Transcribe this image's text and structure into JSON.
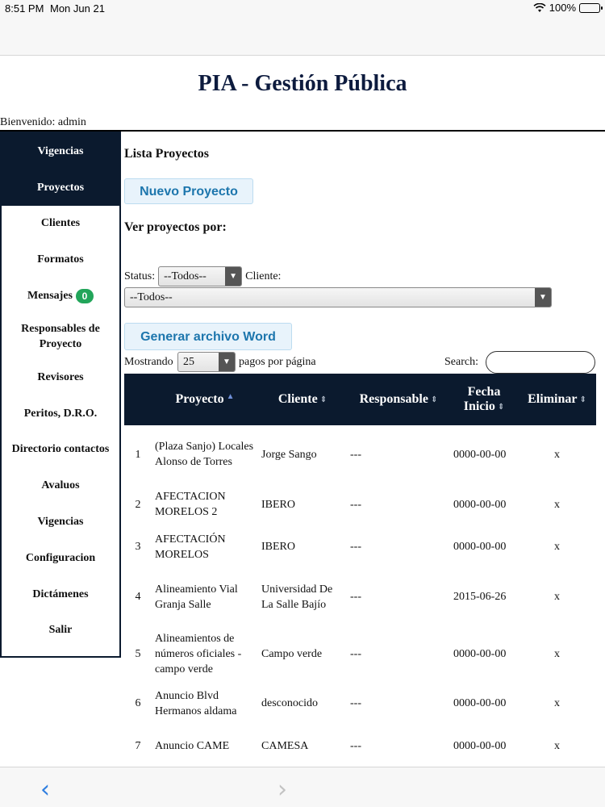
{
  "status_bar": {
    "time": "8:51 PM",
    "date": "Mon Jun 21",
    "battery": "100%"
  },
  "app": {
    "title": "PIA - Gestión Pública",
    "welcome": "Bienvenido: admin"
  },
  "sidebar": {
    "items": [
      {
        "label": "Vigencias"
      },
      {
        "label": "Proyectos"
      },
      {
        "label": "Clientes"
      },
      {
        "label": "Formatos"
      },
      {
        "label": "Mensajes",
        "badge": "0"
      },
      {
        "label": "Responsables de Proyecto"
      },
      {
        "label": "Revisores"
      },
      {
        "label": "Peritos, D.R.O."
      },
      {
        "label": "Directorio contactos"
      },
      {
        "label": "Avaluos"
      },
      {
        "label": "Vigencias"
      },
      {
        "label": "Configuracion"
      },
      {
        "label": "Dictámenes"
      },
      {
        "label": "Salir"
      }
    ]
  },
  "main": {
    "title": "Lista Proyectos",
    "new_button": "Nuevo Proyecto",
    "view_by": "Ver proyectos por:",
    "status_label": "Status:",
    "status_value": "--Todos--",
    "client_label": "Cliente:",
    "client_value": "--Todos--",
    "word_button": "Generar archivo Word",
    "showing_label": "Mostrando",
    "page_size": "25",
    "per_page_label": "pagos por página",
    "search_label": "Search:",
    "search_value": ""
  },
  "table": {
    "headers": [
      "Proyecto",
      "Cliente",
      "Responsable",
      "Fecha Inicio",
      "Eliminar"
    ],
    "rows": [
      {
        "num": "1",
        "proyecto": "(Plaza Sanjo) Locales Alonso de Torres",
        "cliente": "Jorge Sango",
        "responsable": "---",
        "fecha": "0000-00-00",
        "eliminar": "x"
      },
      {
        "num": "2",
        "proyecto": "AFECTACION MORELOS 2",
        "cliente": "IBERO",
        "responsable": "---",
        "fecha": "0000-00-00",
        "eliminar": "x"
      },
      {
        "num": "3",
        "proyecto": "AFECTACIÓN MORELOS",
        "cliente": "IBERO",
        "responsable": "---",
        "fecha": "0000-00-00",
        "eliminar": "x"
      },
      {
        "num": "4",
        "proyecto": "Alineamiento Vial Granja Salle",
        "cliente": "Universidad De La Salle Bajío",
        "responsable": "---",
        "fecha": "2015-06-26",
        "eliminar": "x"
      },
      {
        "num": "5",
        "proyecto": "Alineamientos de números oficiales - campo verde",
        "cliente": "Campo verde",
        "responsable": "---",
        "fecha": "0000-00-00",
        "eliminar": "x"
      },
      {
        "num": "6",
        "proyecto": "Anuncio Blvd Hermanos aldama",
        "cliente": "desconocido",
        "responsable": "---",
        "fecha": "0000-00-00",
        "eliminar": "x"
      },
      {
        "num": "7",
        "proyecto": "Anuncio CAME",
        "cliente": "CAMESA",
        "responsable": "---",
        "fecha": "0000-00-00",
        "eliminar": "x"
      }
    ]
  },
  "colors": {
    "navy": "#0b1a2e",
    "title": "#0d1b3e",
    "button_text": "#1d76ad",
    "badge": "#22a55a",
    "ios_blue": "#2f7fe0"
  }
}
